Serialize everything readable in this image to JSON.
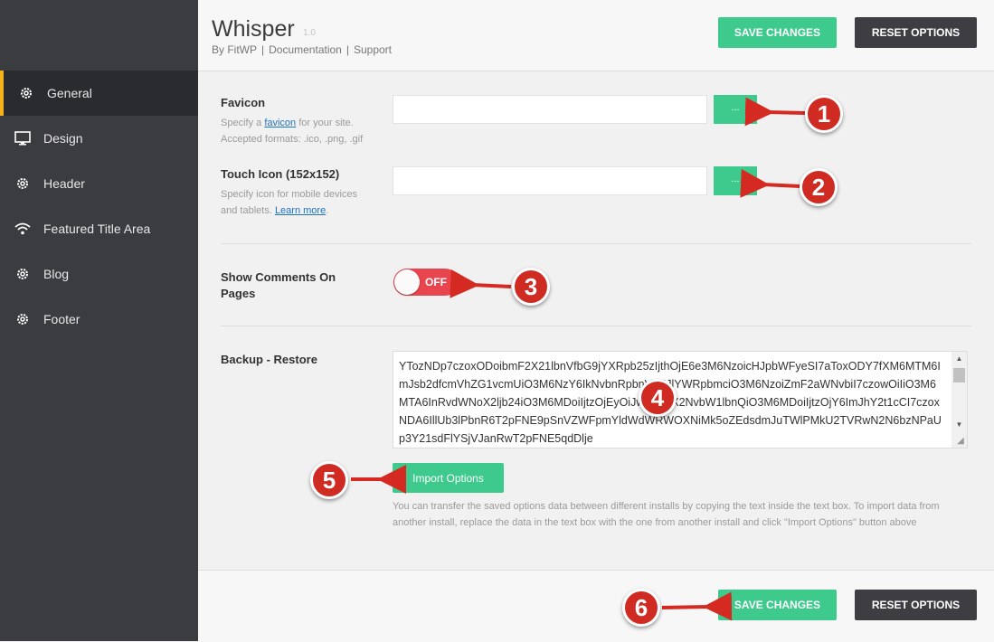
{
  "app": {
    "title": "Whisper",
    "version": "1.0",
    "links": [
      "By FitWP",
      "|",
      "Documentation",
      "|",
      "Support"
    ]
  },
  "header": {
    "save_label": "SAVE CHANGES",
    "reset_label": "RESET OPTIONS"
  },
  "footer": {
    "save_label": "SAVE CHANGES",
    "reset_label": "RESET OPTIONS"
  },
  "sidebar": {
    "items": [
      {
        "label": "General",
        "icon": "gear-icon",
        "active": true
      },
      {
        "label": "Design",
        "icon": "monitor-icon",
        "active": false
      },
      {
        "label": "Header",
        "icon": "gear-icon",
        "active": false
      },
      {
        "label": "Featured Title Area",
        "icon": "wifi-icon",
        "active": false
      },
      {
        "label": "Blog",
        "icon": "gear-icon",
        "active": false
      },
      {
        "label": "Footer",
        "icon": "gear-icon",
        "active": false
      }
    ]
  },
  "favicon": {
    "label": "Favicon",
    "desc_pre": "Specify a ",
    "desc_link": "favicon",
    "desc_post": " for your site.",
    "desc_line2": "Accepted formats: .ico, .png, .gif",
    "value": "",
    "browse_label": "..."
  },
  "touch_icon": {
    "label": "Touch Icon (152x152)",
    "desc_line1": "Specify icon for mobile devices",
    "desc_pre2": "and tablets. ",
    "desc_link": "Learn more",
    "desc_post2": ".",
    "value": "",
    "browse_label": "..."
  },
  "comments": {
    "label_line1": "Show Comments On",
    "label_line2": "Pages",
    "toggle_label": "OFF",
    "on": false
  },
  "backup": {
    "label": "Backup - Restore",
    "text": "YTozNDp7czoxODoibmF2X21lbnVfbG9jYXRpb25zIjthOjE6e3M6NzoicHJpbWFyeSI7aToxODY7fXM6MTM6ImJsb2dfcmVhZG1vcmUiO3M6NzY6IkNvbnRpbnVlIHJlYWRpbmciO3M6NzoiZmF2aWNvbiI7czowOiIiO3M6MTA6InRvdWNoX2ljb24iO3M6MDoiIjtzOjEyOiJwYWdlX2NvbW1lbnQiO3M6MDoiIjtzOjY6ImJhY2t1cCI7czoxNDA6IllUb3lPbnR6T2pFNE9pSnVZWFpmYldWdWRWOXNiMk5oZEdsdmJuTWlPMkU2TVRwN2N6bzNPaUp3Y21sdFlYSjVJanRwT2pFNE5qdDlje",
    "import_label": "Import Options",
    "help": "You can transfer the saved options data between different installs by copying the text inside the text box. To import data from another install, replace the data in the text box with the one from another install and click \"Import Options\" button above"
  },
  "callouts": [
    "1",
    "2",
    "3",
    "4",
    "5",
    "6"
  ],
  "colors": {
    "accent": "#3ec98d",
    "dark_button": "#3e3e42",
    "sidebar": "#3b3c40",
    "active_marker": "#f5b31b",
    "toggle_off": "#e8454f",
    "callout": "#cf2b23"
  }
}
